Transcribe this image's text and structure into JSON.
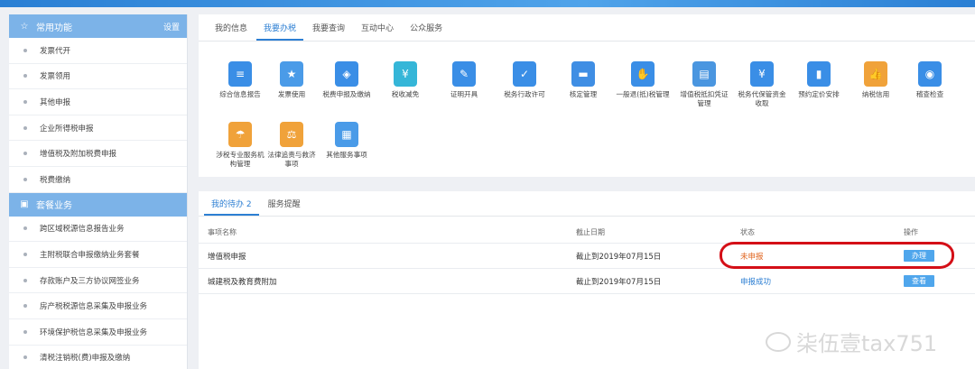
{
  "sidebar": {
    "group1": {
      "title": "常用功能",
      "action": "设置",
      "icon": "star-icon"
    },
    "items1": [
      "发票代开",
      "发票领用",
      "其他申报",
      "企业所得税申报",
      "增值税及附加税费申报",
      "税费缴纳"
    ],
    "group2": {
      "title": "套餐业务",
      "icon": "package-icon"
    },
    "items2": [
      "跨区域税源信息报告业务",
      "主附税联合申报缴纳业务套餐",
      "存款账户及三方协议网签业务",
      "房产税税源信息采集及申报业务",
      "环境保护税信息采集及申报业务",
      "清税注销税(费)申报及缴纳"
    ]
  },
  "nav_tabs": [
    "我的信息",
    "我要办税",
    "我要查询",
    "互动中心",
    "公众服务"
  ],
  "services": [
    {
      "label": "综合信息报告",
      "icon": "doc-report-icon",
      "color": "#3a8ee6"
    },
    {
      "label": "发票使用",
      "icon": "invoice-icon",
      "color": "#4a9be8"
    },
    {
      "label": "税费申报及缴纳",
      "icon": "layers-icon",
      "color": "#3a8ee6"
    },
    {
      "label": "税收减免",
      "icon": "yen-down-icon",
      "color": "#35b6d8"
    },
    {
      "label": "证明开具",
      "icon": "pen-icon",
      "color": "#3a8ee6"
    },
    {
      "label": "税务行政许可",
      "icon": "doc-check-icon",
      "color": "#3a8ee6"
    },
    {
      "label": "核定管理",
      "icon": "folder-icon",
      "color": "#3f8ee4"
    },
    {
      "label": "一般退(抵)税管理",
      "icon": "hand-coin-icon",
      "color": "#3a8ee6"
    },
    {
      "label": "增值税抵扣凭证管理",
      "icon": "ledger-icon",
      "color": "#4a96e0"
    },
    {
      "label": "税务代保管资金收取",
      "icon": "safe-yen-icon",
      "color": "#3a8ee6"
    },
    {
      "label": "预约定价安排",
      "icon": "chart-doc-icon",
      "color": "#3a8ee6"
    },
    {
      "label": "纳税信用",
      "icon": "thumb-icon",
      "color": "#f0a23a"
    },
    {
      "label": "稽查检查",
      "icon": "eye-doc-icon",
      "color": "#3a8ee6"
    },
    {
      "label": "涉税专业服务机构管理",
      "icon": "umbrella-icon",
      "color": "#f0a23a"
    },
    {
      "label": "法律追责与救济事项",
      "icon": "gavel-icon",
      "color": "#f0a23a"
    },
    {
      "label": "其他服务事项",
      "icon": "grid-icon",
      "color": "#4a9be8"
    }
  ],
  "todo": {
    "tabs": [
      {
        "label": "我的待办",
        "count": "2"
      },
      {
        "label": "服务提醒"
      }
    ],
    "headers": [
      "事项名称",
      "截止日期",
      "状态",
      "操作"
    ],
    "rows": [
      {
        "name": "增值税申报",
        "deadline": "截止到2019年07月15日",
        "status": "未申报",
        "status_color": "#e0641e",
        "action": "办理"
      },
      {
        "name": "城建税及教育费附加",
        "deadline": "截止到2019年07月15日",
        "status": "申报成功",
        "status_color": "#2d7fd3",
        "action": "查看"
      }
    ]
  },
  "watermark": "柒伍壹tax751"
}
